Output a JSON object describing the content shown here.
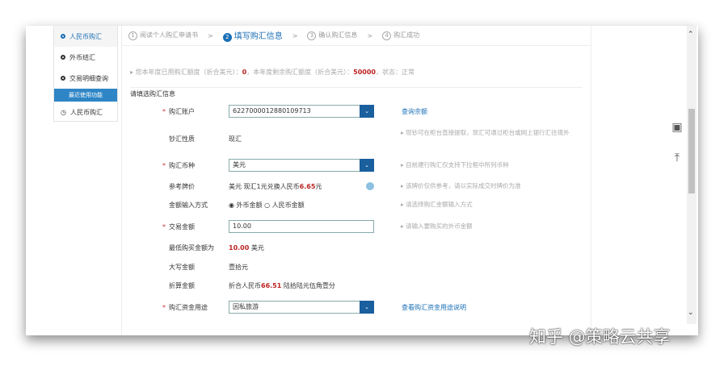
{
  "sidebar": {
    "items": [
      "人民币购汇",
      "外币结汇",
      "交易明细查询"
    ],
    "recent_label": "最近使用功能",
    "recent_items": [
      "人民币购汇"
    ]
  },
  "steps": [
    {
      "n": "1",
      "label": "阅读个人购汇申请书"
    },
    {
      "n": "2",
      "label": "填写购汇信息"
    },
    {
      "n": "3",
      "label": "确认购汇信息"
    },
    {
      "n": "4",
      "label": "购汇成功"
    }
  ],
  "quota": {
    "used_label": "您本年度已用购汇额度（折合美元）：",
    "used": "0",
    "remain_label": "，本年度剩余购汇额度（折合美元）：",
    "remain": "50000",
    "status": "，状态：正常"
  },
  "section_title": "请填选购汇信息",
  "form": {
    "account_label": "购汇账户",
    "account": "6227000012880109713",
    "balance_link": "查询余额",
    "nature_label": "钞汇性质",
    "nature": "现汇",
    "nature_hint": "现钞可在柜台直接提取，现汇可通过柜台或网上银行汇往境外",
    "currency_label": "购汇币种",
    "currency": "美元",
    "currency_hint": "目前建行购汇仅支持下拉框中所列币种",
    "rate_label": "参考牌价",
    "rate_prefix": "美元 现汇1元兑换人民币",
    "rate": "6.65",
    "rate_suffix": "元",
    "rate_hint": "该牌价仅供参考，请以实际成交时牌价为准",
    "mode_label": "金额输入方式",
    "mode_opt1": "外币金额",
    "mode_opt2": "人民币金额",
    "mode_hint": "请选择购汇金额输入方式",
    "amount_label": "交易金额",
    "amount": "10.00",
    "amount_hint": "请输入要购买的外币金额",
    "min_label": "最低购买金额为",
    "min": "10.00",
    "min_unit": "美元",
    "upper_label": "大写金额",
    "upper": "壹拾元",
    "conv_label": "折算金额",
    "conv_prefix": "折合人民币",
    "conv": "66.51",
    "conv_suffix": "陆拾陆元伍角壹分",
    "purpose_label": "购汇资金用途",
    "purpose": "因私旅游",
    "purpose_link": "查看购汇资金用途说明"
  },
  "watermark": "知乎 @策略云共享"
}
